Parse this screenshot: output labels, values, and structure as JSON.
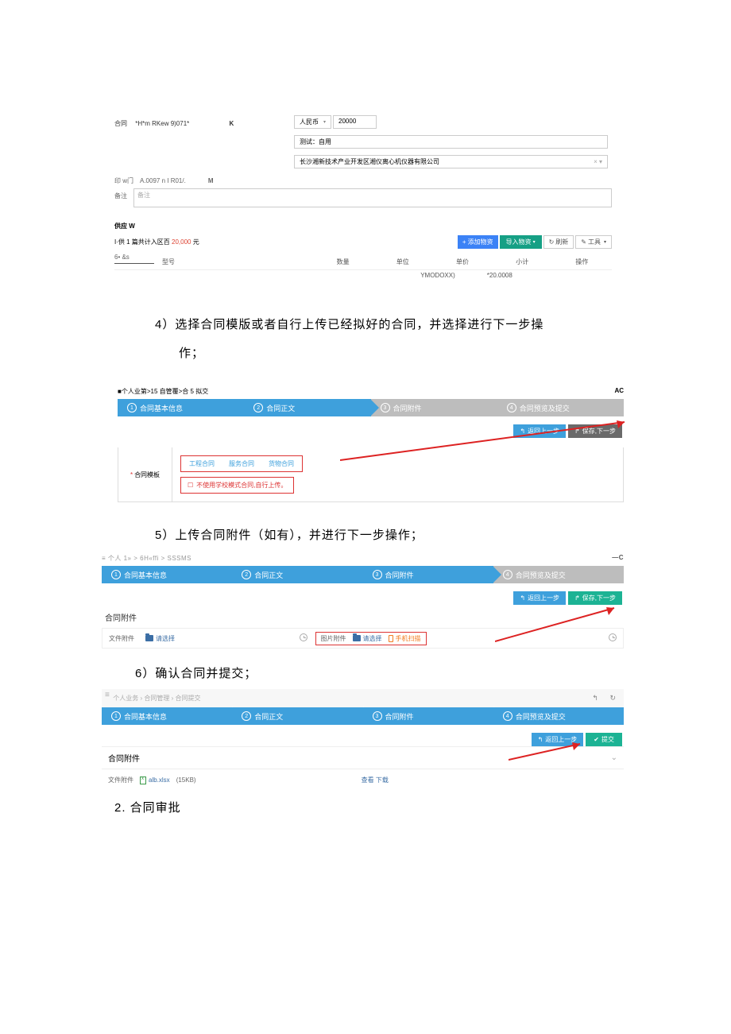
{
  "top": {
    "contract_label": "合同",
    "contract_val": "*H*m RKew 9)071*",
    "k": "K",
    "currency": "人民币",
    "amount": "20000",
    "test_val": "测试：自用",
    "company": "长沙湘新技术产业开发区湘仪离心机仪器有限公司",
    "clear_caret": "× ▾",
    "row2_lbl": "印  w门",
    "row2_val": "A.0097 n  I  R01/.",
    "m": "M",
    "remark_lbl": "备注",
    "remark_ph": "备注"
  },
  "sec2": {
    "title": "供应 W",
    "sum_pre": "I·供 1 篇共计入区百 ",
    "sum_red": "20,000",
    "sum_suf": " 元",
    "btn_add": "添加物资",
    "btn_import": "导入物资",
    "btn_refresh": "刷新",
    "btn_tool": "工具",
    "bxsx": "6• &s",
    "cols": [
      "型号",
      "数量",
      "单位",
      "单价",
      "小计",
      "操作"
    ],
    "sub1": "YMODOXX)",
    "sub2": "*20.0008"
  },
  "wizard4": {
    "crumb": "■个人业第>15 自管覆>合 5 拟交",
    "ac": "AC",
    "steps": [
      "合同基本信息",
      "合同正文",
      "合同附件",
      "合同预览及提交"
    ],
    "prev": "返回上一步",
    "next": "保存,下一步",
    "tmpl_label": "合同模板",
    "opts": [
      "工程合同",
      "服务合同",
      "货物合同"
    ],
    "nouse": "不使用学校模式合同,自行上传。"
  },
  "wizard5": {
    "crumb": "≡ 个人 1» > 6H«ffi > SSSMS",
    "c": "—C",
    "steps": [
      "合同基本信息",
      "合同正文",
      "合同附件",
      "合同预览及提交"
    ],
    "prev": "返回上一步",
    "next": "保存,下一步",
    "attach_title": "合同附件",
    "file_lbl": "文件附件",
    "file_sel": "请选择",
    "img_lbl": "图片附件",
    "img_sel": "请选择",
    "phone": "手机扫描"
  },
  "wizard6": {
    "crumb": "个人业务 › 合同管理 › 合同提交",
    "steps": [
      "合同基本信息",
      "合同正文",
      "合同附件",
      "合同预览及提交"
    ],
    "prev": "返回上一步",
    "submit": "提交",
    "attach_title": "合同附件",
    "file_lbl": "文件附件",
    "file_name": "alb.xlsx",
    "file_size": "(15KB)",
    "download": "查看 下载"
  },
  "doc": {
    "step4": "4）选择合同模版或者自行上传已经拟好的合同，并选择进行下一步操",
    "step4b": "作；",
    "step5": "5）上传合同附件（如有），并进行下一步操作；",
    "step6": "6）确认合同并提交；",
    "h2": "2. 合同审批"
  }
}
